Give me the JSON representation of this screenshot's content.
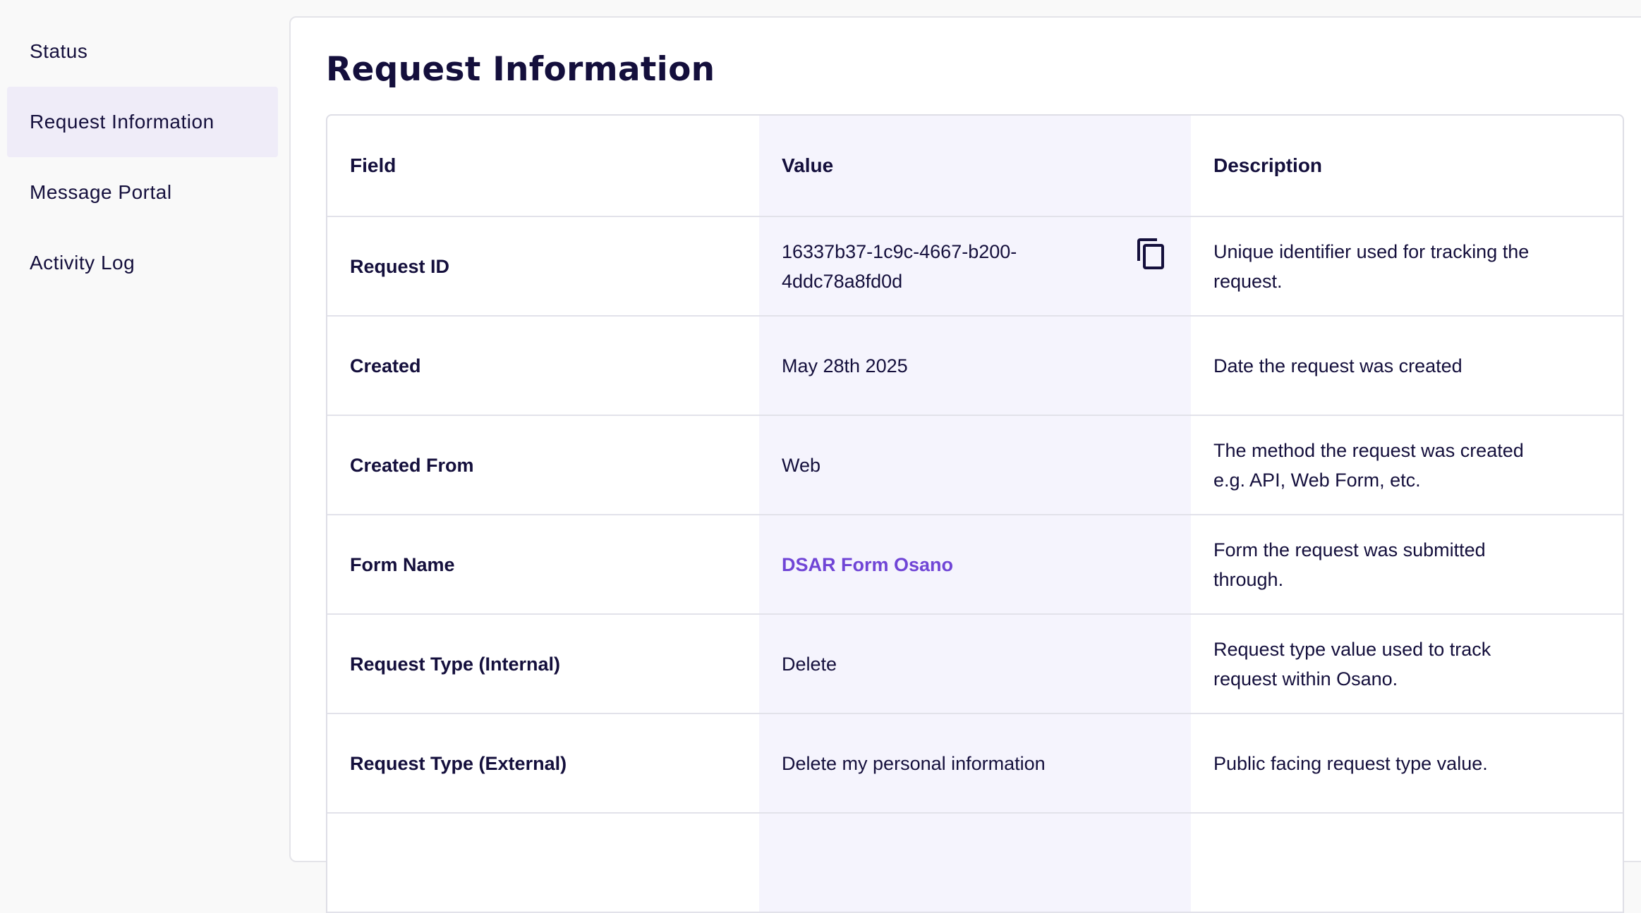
{
  "sidebar": {
    "items": [
      {
        "label": "Status",
        "active": false
      },
      {
        "label": "Request Information",
        "active": true
      },
      {
        "label": "Message Portal",
        "active": false
      },
      {
        "label": "Activity Log",
        "active": false
      }
    ]
  },
  "main": {
    "title": "Request Information",
    "table": {
      "headers": [
        "Field",
        "Value",
        "Description"
      ],
      "rows": [
        {
          "field": "Request ID",
          "value": "16337b37-1c9c-4667-b200-4ddc78a8fd0d",
          "description": "Unique identifier used for tracking the request."
        },
        {
          "field": "Created",
          "value": "May 28th 2025",
          "description": "Date the request was created"
        },
        {
          "field": "Created From",
          "value": "Web",
          "description": "The method the request was created e.g. API, Web Form, etc."
        },
        {
          "field": "Form Name",
          "value": "DSAR Form Osano",
          "description": "Form the request was submitted through."
        },
        {
          "field": "Request Type (Internal)",
          "value": "Delete",
          "description": "Request type value used to track request within Osano."
        },
        {
          "field": "Request Type (External)",
          "value": "Delete my personal information",
          "description": "Public facing request type value."
        }
      ]
    }
  },
  "icons": {
    "copy": "copy-icon"
  },
  "colors": {
    "text": "#140f3c",
    "accent": "#7045d6",
    "active_nav_bg": "#efecf8",
    "value_column_bg": "#f5f4fd"
  }
}
